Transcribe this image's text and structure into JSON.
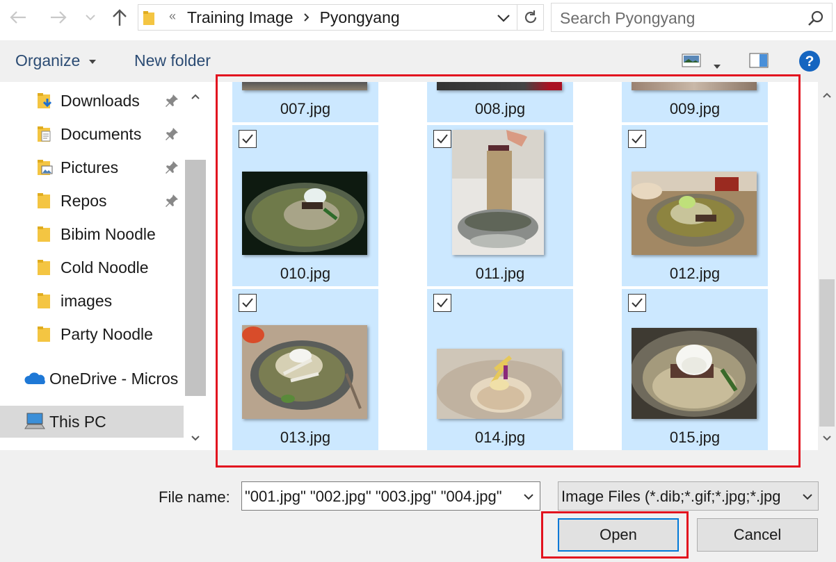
{
  "address_bar": {
    "path": [
      "Training Image",
      "Pyongyang"
    ],
    "overflow_glyph": "«",
    "search_placeholder": "Search Pyongyang"
  },
  "toolbar": {
    "organize_label": "Organize",
    "new_folder_label": "New folder"
  },
  "nav_pane": {
    "items": [
      {
        "label": "Downloads",
        "icon": "downloads-folder-icon",
        "pinned": true
      },
      {
        "label": "Documents",
        "icon": "documents-folder-icon",
        "pinned": true
      },
      {
        "label": "Pictures",
        "icon": "pictures-folder-icon",
        "pinned": true
      },
      {
        "label": "Repos",
        "icon": "folder-icon",
        "pinned": true
      },
      {
        "label": "Bibim Noodle",
        "icon": "folder-icon",
        "pinned": false
      },
      {
        "label": "Cold Noodle",
        "icon": "folder-icon",
        "pinned": false
      },
      {
        "label": "images",
        "icon": "folder-icon",
        "pinned": false
      },
      {
        "label": "Party Noodle",
        "icon": "folder-icon",
        "pinned": false
      },
      {
        "label": "OneDrive - Micros",
        "icon": "onedrive-icon",
        "pinned": false
      },
      {
        "label": "This PC",
        "icon": "computer-icon",
        "pinned": false,
        "selected": true
      }
    ]
  },
  "files": [
    {
      "name": "007.jpg",
      "checked": true
    },
    {
      "name": "008.jpg",
      "checked": true
    },
    {
      "name": "009.jpg",
      "checked": true
    },
    {
      "name": "010.jpg",
      "checked": true
    },
    {
      "name": "011.jpg",
      "checked": true
    },
    {
      "name": "012.jpg",
      "checked": true
    },
    {
      "name": "013.jpg",
      "checked": true
    },
    {
      "name": "014.jpg",
      "checked": true
    },
    {
      "name": "015.jpg",
      "checked": true
    }
  ],
  "bottom": {
    "file_name_label": "File name:",
    "file_name_value": "\"001.jpg\" \"002.jpg\" \"003.jpg\" \"004.jpg\"",
    "file_type_value": "Image Files (*.dib;*.gif;*.jpg;*.jpg",
    "open_label": "Open",
    "cancel_label": "Cancel"
  },
  "colors": {
    "selection": "#cce8ff",
    "highlight_box": "#e2131f",
    "accent": "#0078d7",
    "folder": "#f4c542",
    "help": "#1565c0"
  }
}
